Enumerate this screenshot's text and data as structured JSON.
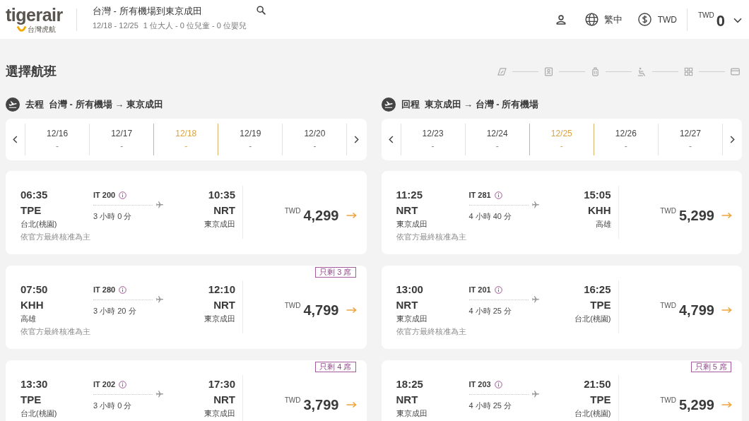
{
  "header": {
    "logo": {
      "wordmark": "tigerair",
      "tagline": "台灣虎航"
    },
    "route_title": "台灣 - 所有機場到東京成田",
    "trip_dates": "12/18 - 12/25",
    "passengers": "1 位大人 - 0 位兒童 - 0 位嬰兒",
    "language": "繁中",
    "currency": "TWD",
    "cart": {
      "currency": "TWD",
      "total": "0"
    }
  },
  "page_title": "選擇航班",
  "legs": [
    {
      "direction": "去程",
      "route": "台灣 - 所有機場 → 東京成田",
      "dates": [
        {
          "date": "12/16",
          "price": "-",
          "selected": false
        },
        {
          "date": "12/17",
          "price": "-",
          "selected": false
        },
        {
          "date": "12/18",
          "price": "-",
          "selected": true
        },
        {
          "date": "12/19",
          "price": "-",
          "selected": false
        },
        {
          "date": "12/20",
          "price": "-",
          "selected": false
        }
      ],
      "flights": [
        {
          "departure": {
            "time": "06:35",
            "code": "TPE",
            "city": "台北(桃園)"
          },
          "flight_no": "IT 200",
          "duration": "3 小時 0 分",
          "arrival": {
            "time": "10:35",
            "code": "NRT",
            "city": "東京成田"
          },
          "note": "依官方最終核准為主",
          "currency": "TWD",
          "price": "4,299"
        },
        {
          "departure": {
            "time": "07:50",
            "code": "KHH",
            "city": "高雄"
          },
          "flight_no": "IT 280",
          "duration": "3 小時 20 分",
          "arrival": {
            "time": "12:10",
            "code": "NRT",
            "city": "東京成田"
          },
          "note": "依官方最終核准為主",
          "currency": "TWD",
          "price": "4,799",
          "seats_left": "只剩 3 席"
        },
        {
          "departure": {
            "time": "13:30",
            "code": "TPE",
            "city": "台北(桃園)"
          },
          "flight_no": "IT 202",
          "duration": "3 小時 0 分",
          "arrival": {
            "time": "17:30",
            "code": "NRT",
            "city": "東京成田"
          },
          "currency": "TWD",
          "price": "3,799",
          "seats_left": "只剩 4 席"
        }
      ]
    },
    {
      "direction": "回程",
      "route": "東京成田 → 台灣 - 所有機場",
      "dates": [
        {
          "date": "12/23",
          "price": "-",
          "selected": false
        },
        {
          "date": "12/24",
          "price": "-",
          "selected": false
        },
        {
          "date": "12/25",
          "price": "-",
          "selected": true
        },
        {
          "date": "12/26",
          "price": "-",
          "selected": false
        },
        {
          "date": "12/27",
          "price": "-",
          "selected": false
        }
      ],
      "flights": [
        {
          "departure": {
            "time": "11:25",
            "code": "NRT",
            "city": "東京成田"
          },
          "flight_no": "IT 281",
          "duration": "4 小時 40 分",
          "arrival": {
            "time": "15:05",
            "code": "KHH",
            "city": "高雄"
          },
          "note": "依官方最終核准為主",
          "currency": "TWD",
          "price": "5,299"
        },
        {
          "departure": {
            "time": "13:00",
            "code": "NRT",
            "city": "東京成田"
          },
          "flight_no": "IT 201",
          "duration": "4 小時 25 分",
          "arrival": {
            "time": "16:25",
            "code": "TPE",
            "city": "台北(桃園)"
          },
          "note": "依官方最終核准為主",
          "currency": "TWD",
          "price": "4,799"
        },
        {
          "departure": {
            "time": "18:25",
            "code": "NRT",
            "city": "東京成田"
          },
          "flight_no": "IT 203",
          "duration": "4 小時 25 分",
          "arrival": {
            "time": "21:50",
            "code": "TPE",
            "city": "台北(桃園)"
          },
          "currency": "TWD",
          "price": "5,299",
          "seats_left": "只剩 5 席"
        }
      ]
    }
  ]
}
